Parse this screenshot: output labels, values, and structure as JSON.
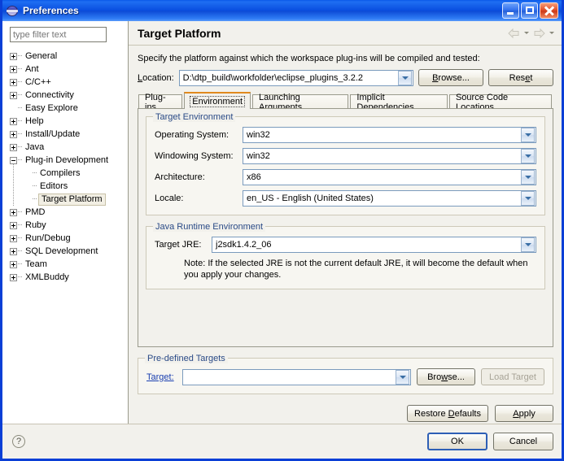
{
  "window": {
    "title": "Preferences",
    "icon": "eclipse-globe-icon",
    "minimize_label": "Minimize",
    "maximize_label": "Maximize",
    "close_label": "Close"
  },
  "sidebar": {
    "filter": {
      "placeholder": "type filter text",
      "value": ""
    },
    "items": [
      {
        "label": "General",
        "expander": "plus",
        "level": 0
      },
      {
        "label": "Ant",
        "expander": "plus",
        "level": 0
      },
      {
        "label": "C/C++",
        "expander": "plus",
        "level": 0
      },
      {
        "label": "Connectivity",
        "expander": "plus",
        "level": 0
      },
      {
        "label": "Easy Explore",
        "expander": "none",
        "level": 0
      },
      {
        "label": "Help",
        "expander": "plus",
        "level": 0
      },
      {
        "label": "Install/Update",
        "expander": "plus",
        "level": 0
      },
      {
        "label": "Java",
        "expander": "plus",
        "level": 0
      },
      {
        "label": "Plug-in Development",
        "expander": "minus",
        "level": 0
      },
      {
        "label": "Compilers",
        "expander": "none",
        "level": 1
      },
      {
        "label": "Editors",
        "expander": "none",
        "level": 1
      },
      {
        "label": "Target Platform",
        "expander": "none",
        "level": 1,
        "selected": true
      },
      {
        "label": "PMD",
        "expander": "plus",
        "level": 0
      },
      {
        "label": "Ruby",
        "expander": "plus",
        "level": 0
      },
      {
        "label": "Run/Debug",
        "expander": "plus",
        "level": 0
      },
      {
        "label": "SQL Development",
        "expander": "plus",
        "level": 0
      },
      {
        "label": "Team",
        "expander": "plus",
        "level": 0
      },
      {
        "label": "XMLBuddy",
        "expander": "plus",
        "level": 0
      }
    ]
  },
  "page": {
    "title": "Target Platform",
    "back_label": "Back",
    "forward_label": "Forward",
    "description": "Specify the platform against which the workspace plug-ins will be compiled and tested:",
    "location_label": "Location:",
    "location_value": "D:\\dtp_build\\workfolder\\eclipse_plugins_3.2.2",
    "browse_label": "Browse...",
    "reset_label": "Reset"
  },
  "tabs": [
    {
      "label": "Plug-ins",
      "active": false
    },
    {
      "label": "Environment",
      "active": true
    },
    {
      "label": "Launching Arguments",
      "active": false
    },
    {
      "label": "Implicit Dependencies",
      "active": false
    },
    {
      "label": "Source Code Locations",
      "active": false
    }
  ],
  "target_environment": {
    "legend": "Target Environment",
    "fields": [
      {
        "label": "Operating System:",
        "value": "win32"
      },
      {
        "label": "Windowing System:",
        "value": "win32"
      },
      {
        "label": "Architecture:",
        "value": "x86"
      },
      {
        "label": "Locale:",
        "value": "en_US - English (United States)"
      }
    ]
  },
  "jre": {
    "legend": "Java Runtime Environment",
    "label": "Target JRE:",
    "value": "j2sdk1.4.2_06",
    "note": "Note: If the selected JRE is not the current default JRE, it will become the default when you apply your changes."
  },
  "predefined": {
    "legend": "Pre-defined Targets",
    "label": "Target:",
    "value": "",
    "browse_label": "Browse...",
    "load_label": "Load Target",
    "load_disabled": true
  },
  "page_buttons": {
    "restore_defaults": "Restore Defaults",
    "apply": "Apply"
  },
  "footer": {
    "help": "?",
    "ok": "OK",
    "cancel": "Cancel"
  },
  "colors": {
    "title_bar": "#0a4fe0",
    "panel_bg": "#f2f1ec",
    "tab_accent": "#e08a1e",
    "group_legend": "#2a4a86",
    "link": "#1a3fb0",
    "default_button_border": "#2e5fb5"
  }
}
